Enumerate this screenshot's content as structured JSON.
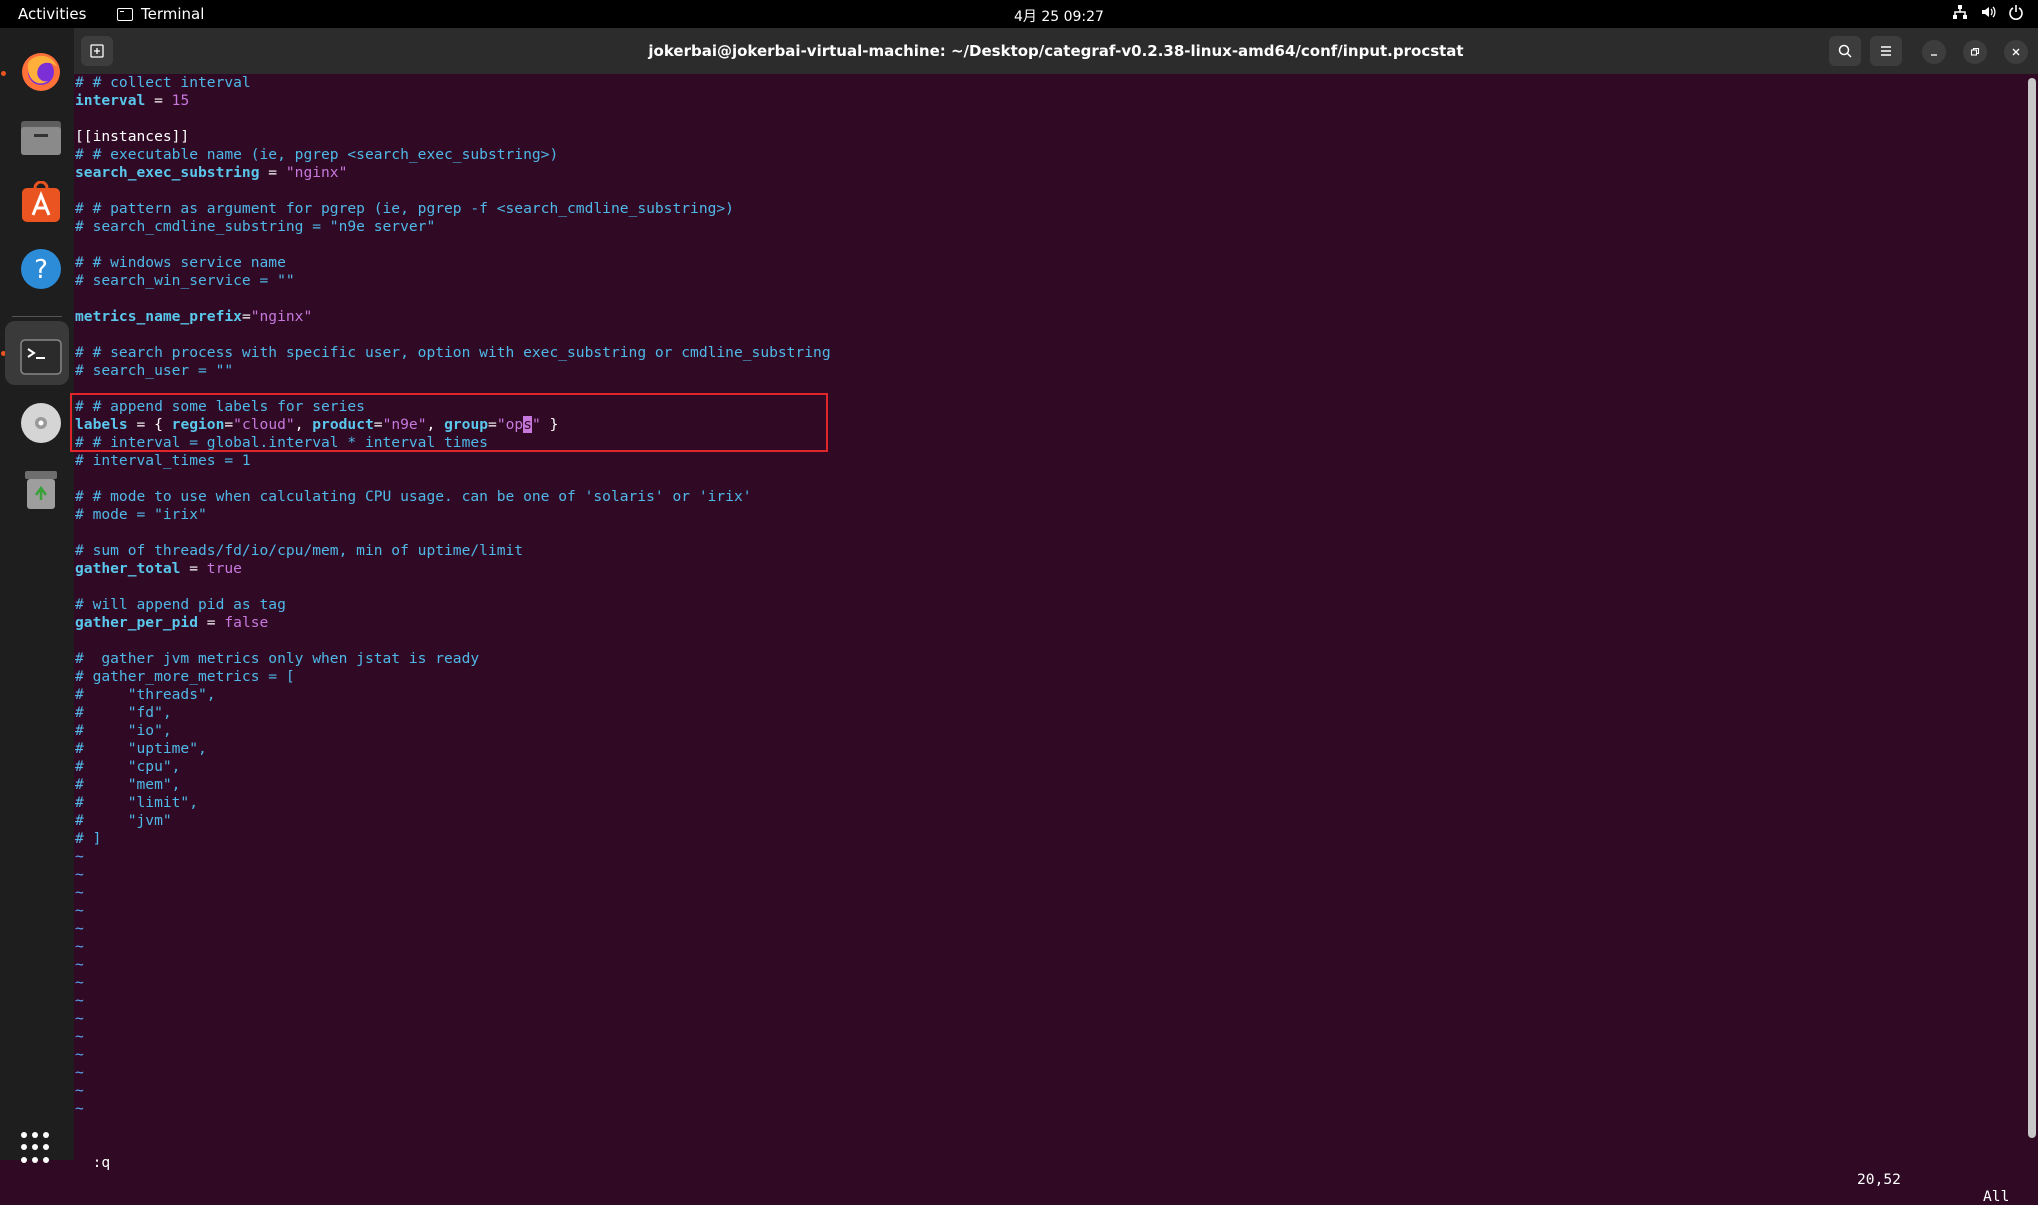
{
  "topbar": {
    "activities": "Activities",
    "app_name": "Terminal",
    "clock": "4月 25  09:27",
    "tray_icons": [
      "network-icon",
      "volume-icon",
      "power-icon"
    ]
  },
  "dock": {
    "items": [
      "firefox-icon",
      "files-icon",
      "app-center-icon",
      "help-icon",
      "terminal-icon",
      "disc-icon",
      "trash-icon"
    ],
    "show_apps": "show-apps-icon"
  },
  "window": {
    "title": "jokerbai@jokerbai-virtual-machine: ~/Desktop/categraf-v0.2.38-linux-amd64/conf/input.procstat",
    "new_tab_icon": "new-tab-icon",
    "search_icon": "search-icon",
    "menu_icon": "hamburger-menu-icon",
    "minimize_icon": "minimize-icon",
    "maximize_icon": "restore-icon",
    "close_icon": "close-icon"
  },
  "editor": {
    "lines": [
      [
        [
          "c",
          "# # collect interval"
        ]
      ],
      [
        [
          "k",
          "interval"
        ],
        [
          "p",
          " = "
        ],
        [
          "n",
          "15"
        ]
      ],
      [
        [
          "p",
          ""
        ]
      ],
      [
        [
          "p",
          "[[instances]]"
        ]
      ],
      [
        [
          "c",
          "# # executable name (ie, pgrep <search_exec_substring>)"
        ]
      ],
      [
        [
          "k",
          "search_exec_substring"
        ],
        [
          "p",
          " = "
        ],
        [
          "s",
          "\"nginx\""
        ]
      ],
      [
        [
          "p",
          ""
        ]
      ],
      [
        [
          "c",
          "# # pattern as argument for pgrep (ie, pgrep -f <search_cmdline_substring>)"
        ]
      ],
      [
        [
          "c",
          "# search_cmdline_substring = \"n9e server\""
        ]
      ],
      [
        [
          "p",
          ""
        ]
      ],
      [
        [
          "c",
          "# # windows service name"
        ]
      ],
      [
        [
          "c",
          "# search_win_service = \"\""
        ]
      ],
      [
        [
          "p",
          ""
        ]
      ],
      [
        [
          "k",
          "metrics_name_prefix"
        ],
        [
          "p",
          "="
        ],
        [
          "s",
          "\"nginx\""
        ]
      ],
      [
        [
          "p",
          ""
        ]
      ],
      [
        [
          "c",
          "# # search process with specific user, option with exec_substring or cmdline_substring"
        ]
      ],
      [
        [
          "c",
          "# search_user = \"\""
        ]
      ],
      [
        [
          "p",
          ""
        ]
      ],
      [
        [
          "c",
          "# # append some labels for series"
        ]
      ],
      [
        [
          "k",
          "labels"
        ],
        [
          "p",
          " = { "
        ],
        [
          "k",
          "region"
        ],
        [
          "p",
          "="
        ],
        [
          "s",
          "\"cloud\""
        ],
        [
          "p",
          ", "
        ],
        [
          "k",
          "product"
        ],
        [
          "p",
          "="
        ],
        [
          "s",
          "\"n9e\""
        ],
        [
          "p",
          ", "
        ],
        [
          "k",
          "group"
        ],
        [
          "p",
          "="
        ],
        [
          "s",
          "\"op"
        ],
        [
          "cursor",
          "s"
        ],
        [
          "s",
          "\""
        ],
        [
          "p",
          " }"
        ]
      ],
      [
        [
          "c",
          "# # interval = global.interval * interval_times"
        ]
      ],
      [
        [
          "c",
          "# interval_times = 1"
        ]
      ],
      [
        [
          "p",
          ""
        ]
      ],
      [
        [
          "c",
          "# # mode to use when calculating CPU usage. can be one of 'solaris' or 'irix'"
        ]
      ],
      [
        [
          "c",
          "# mode = \"irix\""
        ]
      ],
      [
        [
          "p",
          ""
        ]
      ],
      [
        [
          "c",
          "# sum of threads/fd/io/cpu/mem, min of uptime/limit"
        ]
      ],
      [
        [
          "k",
          "gather_total"
        ],
        [
          "p",
          " = "
        ],
        [
          "n",
          "true"
        ]
      ],
      [
        [
          "p",
          ""
        ]
      ],
      [
        [
          "c",
          "# will append pid as tag"
        ]
      ],
      [
        [
          "k",
          "gather_per_pid"
        ],
        [
          "p",
          " = "
        ],
        [
          "n",
          "false"
        ]
      ],
      [
        [
          "p",
          ""
        ]
      ],
      [
        [
          "c",
          "#  gather jvm metrics only when jstat is ready"
        ]
      ],
      [
        [
          "c",
          "# gather_more_metrics = ["
        ]
      ],
      [
        [
          "c",
          "#     \"threads\","
        ]
      ],
      [
        [
          "c",
          "#     \"fd\","
        ]
      ],
      [
        [
          "c",
          "#     \"io\","
        ]
      ],
      [
        [
          "c",
          "#     \"uptime\","
        ]
      ],
      [
        [
          "c",
          "#     \"cpu\","
        ]
      ],
      [
        [
          "c",
          "#     \"mem\","
        ]
      ],
      [
        [
          "c",
          "#     \"limit\","
        ]
      ],
      [
        [
          "c",
          "#     \"jvm\""
        ]
      ],
      [
        [
          "c",
          "# ]"
        ]
      ],
      [
        [
          "t",
          "~"
        ]
      ],
      [
        [
          "t",
          "~"
        ]
      ],
      [
        [
          "t",
          "~"
        ]
      ],
      [
        [
          "t",
          "~"
        ]
      ],
      [
        [
          "t",
          "~"
        ]
      ],
      [
        [
          "t",
          "~"
        ]
      ],
      [
        [
          "t",
          "~"
        ]
      ],
      [
        [
          "t",
          "~"
        ]
      ],
      [
        [
          "t",
          "~"
        ]
      ],
      [
        [
          "t",
          "~"
        ]
      ],
      [
        [
          "t",
          "~"
        ]
      ],
      [
        [
          "t",
          "~"
        ]
      ],
      [
        [
          "t",
          "~"
        ]
      ],
      [
        [
          "t",
          "~"
        ]
      ],
      [
        [
          "t",
          "~"
        ]
      ]
    ],
    "command": ":q",
    "cursor_position": "20,52",
    "scroll_position": "All"
  }
}
